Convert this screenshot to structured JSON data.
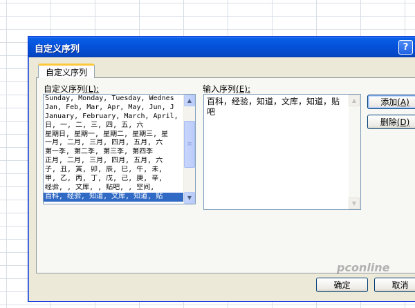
{
  "dialog": {
    "title": "自定义序列",
    "help_label": "?",
    "tab_label": "自定义序列"
  },
  "left_panel": {
    "label_text": "自定义序列",
    "label_key": "(L):",
    "items": [
      "Sunday, Monday, Tuesday, Wednes",
      "Jan, Feb, Mar, Apr, May, Jun, J",
      "January, February, March, April,",
      "日, 一, 二, 三, 四, 五, 六",
      "星期日, 星期一, 星期二, 星期三, 星",
      "一月, 二月, 三月, 四月, 五月, 六",
      "第一季, 第二季, 第三季, 第四季",
      "正月, 二月, 三月, 四月, 五月, 六",
      "子, 丑, 寅, 卯, 辰, 巳, 午, 未,",
      "甲, 乙, 丙, 丁, 戊, 己, 庚, 辛,",
      "经验, , 文库, , 贴吧, , 空间,",
      "百科, 经验, 知道, 文库, 知道, 贴"
    ],
    "selected_index": 11
  },
  "right_panel": {
    "label_text": "输入序列",
    "label_key": "(E):",
    "value": "百科，经验，知道，文库，知道，贴吧"
  },
  "buttons": {
    "add_text": "添加",
    "add_key": "(A)",
    "delete_text": "删除",
    "delete_key": "(D)",
    "ok": "确定",
    "cancel": "取消"
  },
  "watermark": "pconline"
}
